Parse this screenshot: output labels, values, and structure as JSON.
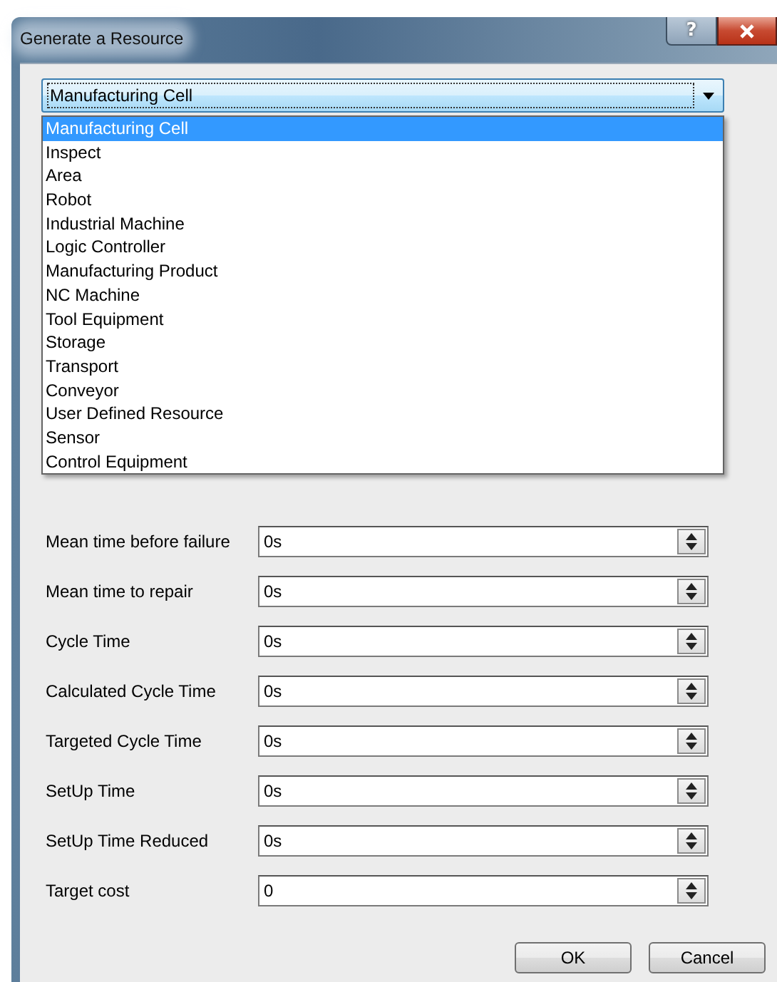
{
  "window": {
    "title": "Generate a Resource",
    "help_button": "?"
  },
  "combo": {
    "value": "Manufacturing Cell",
    "expanded": true,
    "options": [
      {
        "label": "Manufacturing Cell",
        "selected": true
      },
      {
        "label": "Inspect",
        "selected": false
      },
      {
        "label": "Area",
        "selected": false
      },
      {
        "label": "Robot",
        "selected": false
      },
      {
        "label": "Industrial Machine",
        "selected": false
      },
      {
        "label": "Logic Controller",
        "selected": false
      },
      {
        "label": "Manufacturing Product",
        "selected": false
      },
      {
        "label": "NC Machine",
        "selected": false
      },
      {
        "label": "Tool Equipment",
        "selected": false
      },
      {
        "label": "Storage",
        "selected": false
      },
      {
        "label": "Transport",
        "selected": false
      },
      {
        "label": "Conveyor",
        "selected": false
      },
      {
        "label": "User Defined Resource",
        "selected": false
      },
      {
        "label": "Sensor",
        "selected": false
      },
      {
        "label": "Control Equipment",
        "selected": false
      }
    ]
  },
  "fields": [
    {
      "label": "Mean time before failure",
      "value": "0s"
    },
    {
      "label": "Mean time to repair",
      "value": "0s"
    },
    {
      "label": "Cycle Time",
      "value": "0s"
    },
    {
      "label": "Calculated Cycle Time",
      "value": "0s"
    },
    {
      "label": "Targeted Cycle Time",
      "value": "0s"
    },
    {
      "label": "SetUp Time",
      "value": "0s"
    },
    {
      "label": "SetUp Time Reduced",
      "value": "0s"
    },
    {
      "label": "Target cost",
      "value": "0"
    }
  ],
  "buttons": [
    "OK",
    "Cancel"
  ]
}
